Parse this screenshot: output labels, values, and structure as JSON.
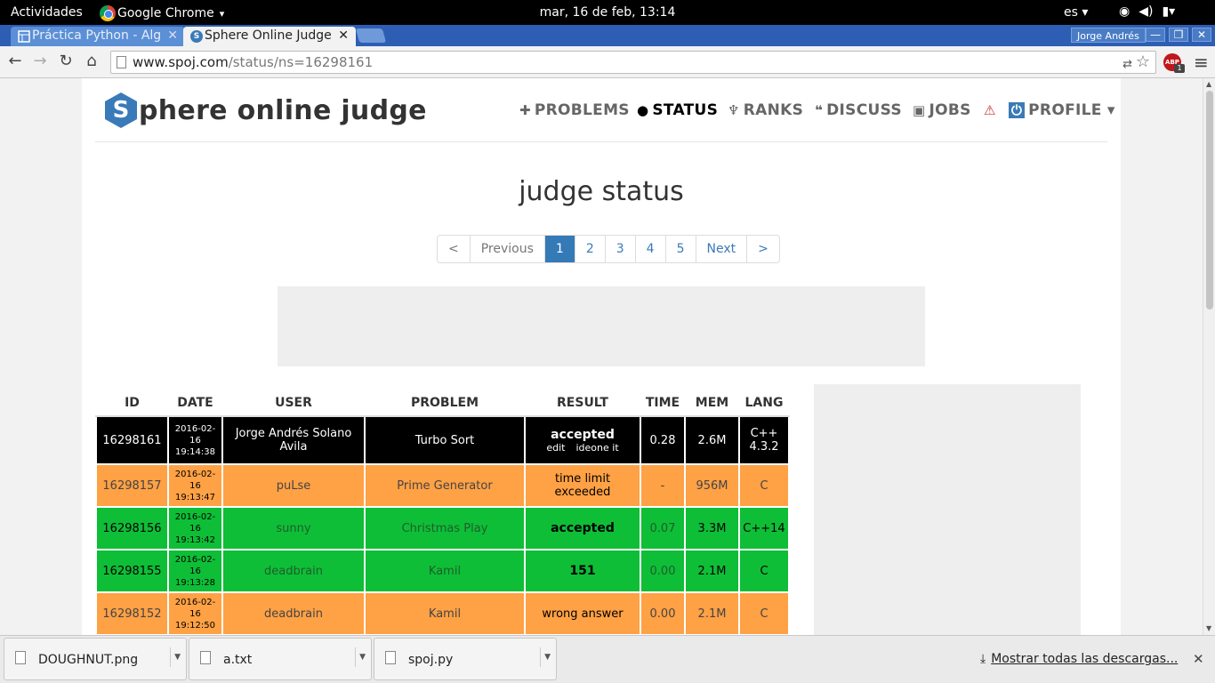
{
  "system_bar": {
    "activities": "Actividades",
    "app_name": "Google Chrome",
    "app_arrow": "▾",
    "clock": "mar, 16 de feb, 13:14",
    "lang": "es ▾",
    "icons": [
      "wifi-icon",
      "volume-icon",
      "battery-icon"
    ]
  },
  "tabs": [
    {
      "title": "Práctica Python - Alg",
      "close": "✕"
    },
    {
      "title": "Sphere Online Judge",
      "close": "✕",
      "favicon": "S"
    }
  ],
  "window": {
    "user": "Jorge Andrés",
    "minimize": "—",
    "restore": "❐",
    "close": "✕"
  },
  "address": {
    "host": "www.spoj.com",
    "path": "/status/ns=16298161"
  },
  "toolbar_icons": {
    "back": "←",
    "forward": "→",
    "reload": "↻",
    "home": "⌂",
    "star": "☆",
    "translate": "⇄",
    "menu": "≡",
    "abp": "ABP",
    "abp_count": "1"
  },
  "site": {
    "logo_letter": "S",
    "logo_text": "phere online judge",
    "nav": [
      {
        "icon": "✚",
        "label": "PROBLEMS"
      },
      {
        "icon": "●",
        "label": "STATUS"
      },
      {
        "icon": "♆",
        "label": "RANKS"
      },
      {
        "icon": "❝",
        "label": "DISCUSS"
      },
      {
        "icon": "▣",
        "label": "JOBS"
      },
      {
        "icon": "⚠",
        "label": ""
      },
      {
        "icon": "⏻",
        "label": "PROFILE ▾"
      }
    ]
  },
  "page_title": "judge status",
  "pagination": [
    "<",
    "Previous",
    "1",
    "2",
    "3",
    "4",
    "5",
    "Next",
    ">"
  ],
  "table": {
    "headers": [
      "ID",
      "DATE",
      "USER",
      "PROBLEM",
      "RESULT",
      "TIME",
      "MEM",
      "LANG"
    ],
    "rows": [
      {
        "id": "16298161",
        "date": [
          "2016-02-",
          "16",
          "19:14:38"
        ],
        "user": "Jorge Andrés Solano Avila",
        "problem": "Turbo Sort",
        "result": "accepted",
        "result_sub": [
          "edit",
          "ideone it"
        ],
        "time": "0.28",
        "mem": "2.6M",
        "lang": "C++ 4.3.2",
        "color": "black"
      },
      {
        "id": "16298157",
        "date": [
          "2016-02-",
          "16",
          "19:13:47"
        ],
        "user": "puLse",
        "problem": "Prime Generator",
        "result": "time limit exceeded",
        "time": "-",
        "mem": "956M",
        "lang": "C",
        "color": "orange"
      },
      {
        "id": "16298156",
        "date": [
          "2016-02-",
          "16",
          "19:13:42"
        ],
        "user": "sunny",
        "problem": "Christmas Play",
        "result": "accepted",
        "time": "0.07",
        "mem": "3.3M",
        "lang": "C++14",
        "color": "green"
      },
      {
        "id": "16298155",
        "date": [
          "2016-02-",
          "16",
          "19:13:28"
        ],
        "user": "deadbrain",
        "problem": "Kamil",
        "result": "151",
        "time": "0.00",
        "mem": "2.1M",
        "lang": "C",
        "color": "green"
      },
      {
        "id": "16298152",
        "date": [
          "2016-02-",
          "16",
          "19:12:50"
        ],
        "user": "deadbrain",
        "problem": "Kamil",
        "result": "wrong answer",
        "time": "0.00",
        "mem": "2.1M",
        "lang": "C",
        "color": "orange"
      }
    ]
  },
  "downloads": [
    {
      "name": "DOUGHNUT.png"
    },
    {
      "name": "a.txt"
    },
    {
      "name": "spoj.py"
    }
  ],
  "show_all": "Mostrar todas las descargas...",
  "shelf_close": "✕"
}
